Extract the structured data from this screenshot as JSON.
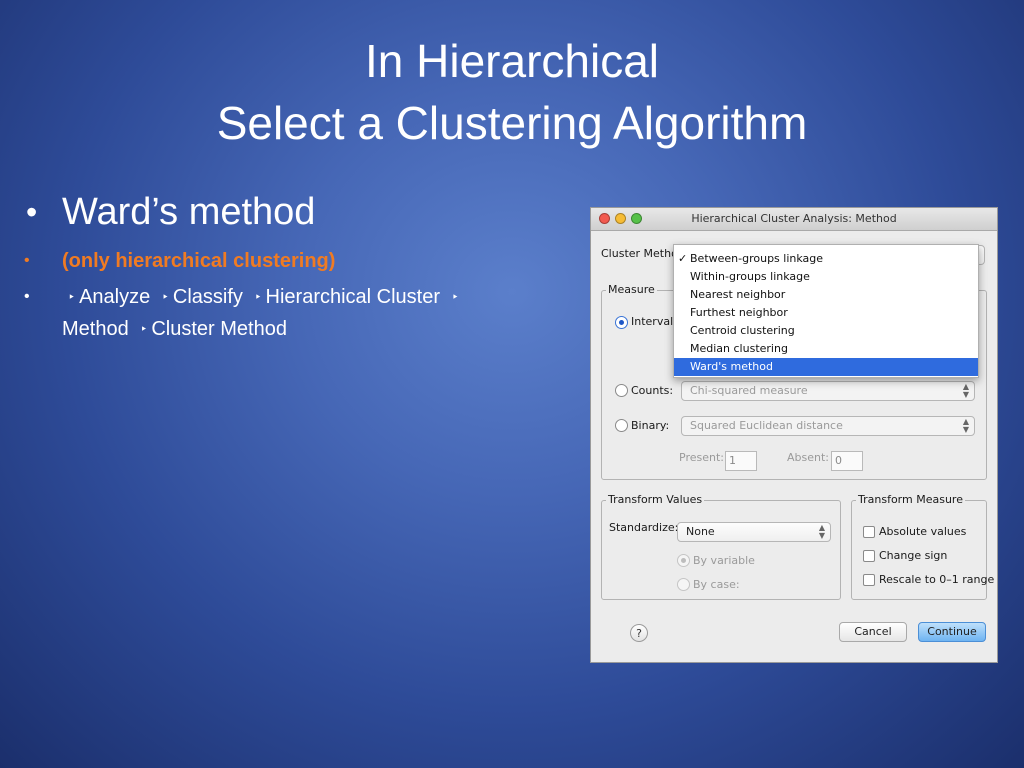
{
  "slide": {
    "title_line1": "In Hierarchical",
    "title_line2": "Select a Clustering Algorithm",
    "bullet_main_marker": "•",
    "bullet_main": "Ward’s method",
    "bullet_sub_marker": "•",
    "bullet_note": "(only hierarchical clustering)",
    "nav_path": [
      "Analyze",
      "Classify",
      "Hierarchical Cluster",
      "Method",
      "Cluster Method"
    ],
    "nav_separator": "‣"
  },
  "dialog": {
    "title": "Hierarchical Cluster Analysis: Method",
    "cluster_method_label": "Cluster Method:",
    "cluster_method_menu": {
      "check_mark": "✓",
      "items": [
        "Between-groups linkage",
        "Within-groups linkage",
        "Nearest neighbor",
        "Furthest neighbor",
        "Centroid clustering",
        "Median clustering",
        "Ward's method"
      ],
      "checked": "Between-groups linkage",
      "highlighted": "Ward's method"
    },
    "measure": {
      "group_label": "Measure",
      "interval_label": "Interval:",
      "counts_label": "Counts:",
      "counts_value": "Chi-squared measure",
      "binary_label": "Binary:",
      "binary_value": "Squared Euclidean distance",
      "present_label": "Present:",
      "present_value": "1",
      "absent_label": "Absent:",
      "absent_value": "0",
      "selected": "Interval"
    },
    "transform_values": {
      "group_label": "Transform Values",
      "standardize_label": "Standardize:",
      "standardize_value": "None",
      "by_variable_label": "By variable",
      "by_case_label": "By case:"
    },
    "transform_measure": {
      "group_label": "Transform Measure",
      "absolute_label": "Absolute values",
      "change_sign_label": "Change sign",
      "rescale_label": "Rescale to 0–1 range"
    },
    "help_label": "?",
    "cancel_label": "Cancel",
    "continue_label": "Continue"
  },
  "colors": {
    "title_text": "#ffffff",
    "note_orange": "#f07b22",
    "menu_highlight": "#2f6bde",
    "continue_button": "#6fb4f2"
  }
}
